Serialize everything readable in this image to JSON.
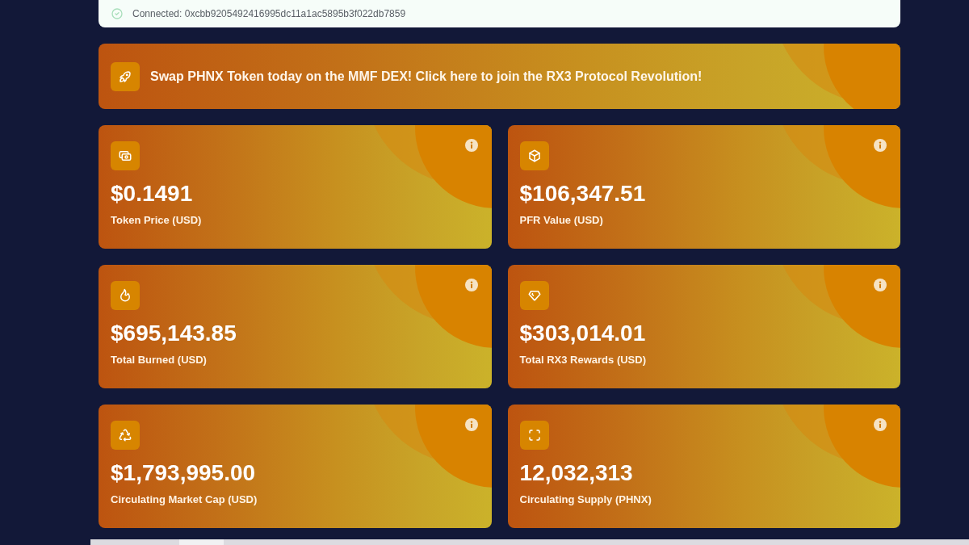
{
  "connection": {
    "status_text": "Connected: 0xcbb9205492416995dc11a1ac5895b3f022db7859"
  },
  "banner": {
    "text": "Swap PHNX Token today on the MMF DEX! Click here to join the RX3 Protocol Revolution!"
  },
  "stats": [
    {
      "value": "$0.1491",
      "label": "Token Price (USD)"
    },
    {
      "value": "$106,347.51",
      "label": "PFR Value (USD)"
    },
    {
      "value": "$695,143.85",
      "label": "Total Burned (USD)"
    },
    {
      "value": "$303,014.01",
      "label": "Total RX3 Rewards (USD)"
    },
    {
      "value": "$1,793,995.00",
      "label": "Circulating Market Cap (USD)"
    },
    {
      "value": "12,032,313",
      "label": "Circulating Supply (PHNX)"
    }
  ]
}
